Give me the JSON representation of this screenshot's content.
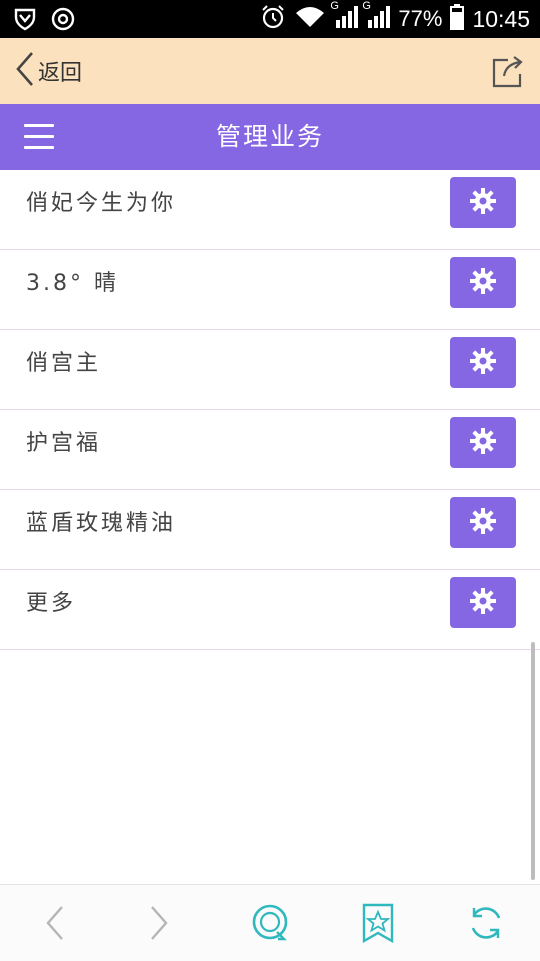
{
  "status_bar": {
    "battery": "77%",
    "time": "10:45",
    "network_label_1": "G",
    "network_label_2": "G",
    "icons": [
      "shield-icon",
      "settings-ring-icon",
      "alarm-icon",
      "wifi-icon",
      "signal-icon",
      "battery-icon"
    ]
  },
  "top_bar": {
    "back_label": "返回",
    "icons": [
      "chevron-left-icon",
      "share-icon"
    ]
  },
  "header": {
    "title": "管理业务",
    "icons": [
      "menu-icon"
    ]
  },
  "list": {
    "items": [
      {
        "label": "俏妃今生为你"
      },
      {
        "label": "3.8° 晴"
      },
      {
        "label": "俏宫主"
      },
      {
        "label": "护宫福"
      },
      {
        "label": "蓝盾玫瑰精油"
      },
      {
        "label": "更多"
      }
    ],
    "button_icon": "gear-icon"
  },
  "bottom_bar": {
    "icons": [
      "back-arrow-icon",
      "forward-arrow-icon",
      "chat-icon",
      "bookmark-star-icon",
      "refresh-icon"
    ]
  },
  "colors": {
    "header_bg": "#8567e4",
    "topbar_bg": "#fbe1bd",
    "accent_icons": "#2fb8bd"
  }
}
